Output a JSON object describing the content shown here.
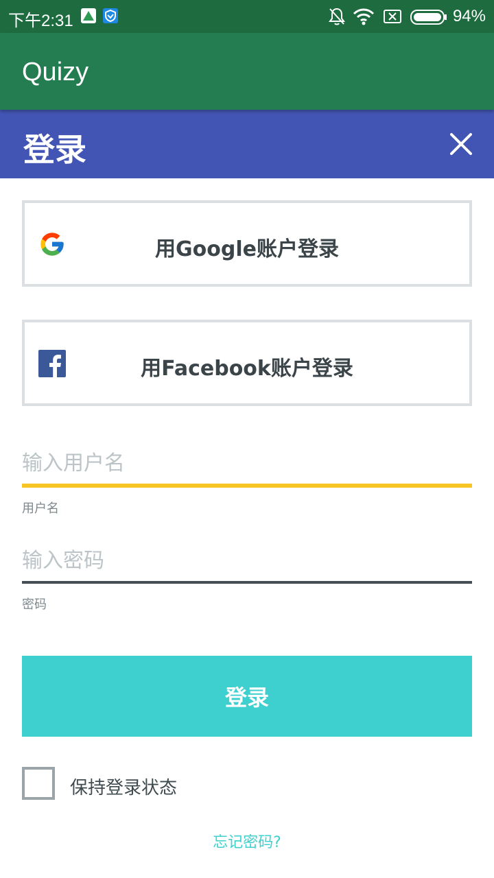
{
  "status_bar": {
    "time": "下午2:31",
    "battery_percent": "94%",
    "icons": [
      "notification-app-icon",
      "shield-app-icon",
      "bell-off-icon",
      "wifi-icon",
      "no-sim-icon",
      "battery-icon"
    ]
  },
  "app_bar": {
    "title": "Quizy",
    "color": "#237d50"
  },
  "dialog": {
    "title": "登录",
    "header_color": "#4355b4",
    "close_icon": "close-icon"
  },
  "social": {
    "google_label": "用Google账户登录",
    "google_icon": "google-icon",
    "facebook_label": "用Facebook账户登录",
    "facebook_icon": "facebook-icon"
  },
  "form": {
    "username": {
      "value": "",
      "placeholder": "输入用户名",
      "helper": "用户名",
      "focus_color": "#f6c624"
    },
    "password": {
      "value": "",
      "placeholder": "输入密码",
      "helper": "密码"
    },
    "login_button": "登录",
    "login_color": "#3ecfcf",
    "remember_label": "保持登录状态",
    "remember_checked": false,
    "forgot_link": "忘记密码?"
  }
}
